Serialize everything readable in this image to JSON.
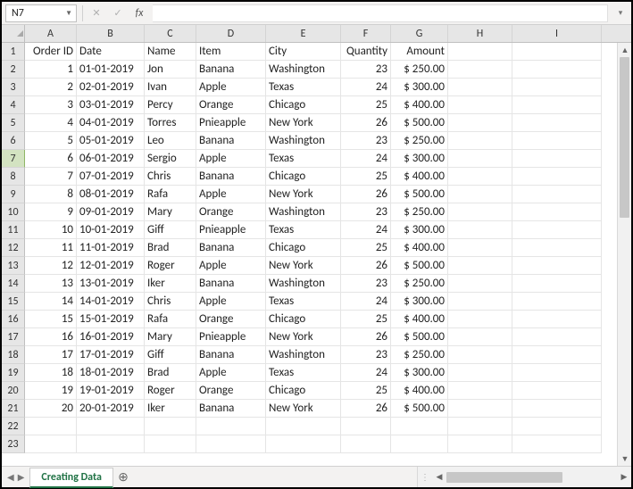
{
  "name_box": "N7",
  "formula_value": "",
  "columns": [
    "A",
    "B",
    "C",
    "D",
    "E",
    "F",
    "G",
    "H",
    "I"
  ],
  "col_widths": [
    "wA",
    "wB",
    "wC",
    "wD",
    "wE",
    "wF",
    "wG",
    "wH",
    "wI"
  ],
  "selected_row_header": 7,
  "headers_row_index": 1,
  "headers": {
    "A": "Order ID",
    "B": "Date",
    "C": "Name",
    "D": "Item",
    "E": "City",
    "F": "Quantity",
    "G": "Amount"
  },
  "data_rows": [
    {
      "rn": 2,
      "A": "1",
      "B": "01-01-2019",
      "C": "Jon",
      "D": "Banana",
      "E": "Washington",
      "F": "23",
      "G": "$ 250.00"
    },
    {
      "rn": 3,
      "A": "2",
      "B": "02-01-2019",
      "C": "Ivan",
      "D": "Apple",
      "E": "Texas",
      "F": "24",
      "G": "$ 300.00"
    },
    {
      "rn": 4,
      "A": "3",
      "B": "03-01-2019",
      "C": "Percy",
      "D": "Orange",
      "E": "Chicago",
      "F": "25",
      "G": "$ 400.00"
    },
    {
      "rn": 5,
      "A": "4",
      "B": "04-01-2019",
      "C": "Torres",
      "D": "Pnieapple",
      "E": "New York",
      "F": "26",
      "G": "$ 500.00"
    },
    {
      "rn": 6,
      "A": "5",
      "B": "05-01-2019",
      "C": "Leo",
      "D": "Banana",
      "E": "Washington",
      "F": "23",
      "G": "$ 250.00"
    },
    {
      "rn": 7,
      "A": "6",
      "B": "06-01-2019",
      "C": "Sergio",
      "D": "Apple",
      "E": "Texas",
      "F": "24",
      "G": "$ 300.00"
    },
    {
      "rn": 8,
      "A": "7",
      "B": "07-01-2019",
      "C": "Chris",
      "D": "Banana",
      "E": "Chicago",
      "F": "25",
      "G": "$ 400.00"
    },
    {
      "rn": 9,
      "A": "8",
      "B": "08-01-2019",
      "C": "Rafa",
      "D": "Apple",
      "E": "New York",
      "F": "26",
      "G": "$ 500.00"
    },
    {
      "rn": 10,
      "A": "9",
      "B": "09-01-2019",
      "C": "Mary",
      "D": "Orange",
      "E": "Washington",
      "F": "23",
      "G": "$ 250.00"
    },
    {
      "rn": 11,
      "A": "10",
      "B": "10-01-2019",
      "C": "Giff",
      "D": "Pnieapple",
      "E": "Texas",
      "F": "24",
      "G": "$ 300.00"
    },
    {
      "rn": 12,
      "A": "11",
      "B": "11-01-2019",
      "C": "Brad",
      "D": "Banana",
      "E": "Chicago",
      "F": "25",
      "G": "$ 400.00"
    },
    {
      "rn": 13,
      "A": "12",
      "B": "12-01-2019",
      "C": "Roger",
      "D": "Apple",
      "E": "New York",
      "F": "26",
      "G": "$ 500.00"
    },
    {
      "rn": 14,
      "A": "13",
      "B": "13-01-2019",
      "C": "Iker",
      "D": "Banana",
      "E": "Washington",
      "F": "23",
      "G": "$ 250.00"
    },
    {
      "rn": 15,
      "A": "14",
      "B": "14-01-2019",
      "C": "Chris",
      "D": "Apple",
      "E": "Texas",
      "F": "24",
      "G": "$ 300.00"
    },
    {
      "rn": 16,
      "A": "15",
      "B": "15-01-2019",
      "C": "Rafa",
      "D": "Orange",
      "E": "Chicago",
      "F": "25",
      "G": "$ 400.00"
    },
    {
      "rn": 17,
      "A": "16",
      "B": "16-01-2019",
      "C": "Mary",
      "D": "Pnieapple",
      "E": "New York",
      "F": "26",
      "G": "$ 500.00"
    },
    {
      "rn": 18,
      "A": "17",
      "B": "17-01-2019",
      "C": "Giff",
      "D": "Banana",
      "E": "Washington",
      "F": "23",
      "G": "$ 250.00"
    },
    {
      "rn": 19,
      "A": "18",
      "B": "18-01-2019",
      "C": "Brad",
      "D": "Apple",
      "E": "Texas",
      "F": "24",
      "G": "$ 300.00"
    },
    {
      "rn": 20,
      "A": "19",
      "B": "19-01-2019",
      "C": "Roger",
      "D": "Orange",
      "E": "Chicago",
      "F": "25",
      "G": "$ 400.00"
    },
    {
      "rn": 21,
      "A": "20",
      "B": "20-01-2019",
      "C": "Iker",
      "D": "Banana",
      "E": "New York",
      "F": "26",
      "G": "$ 500.00"
    }
  ],
  "trailing_blank_rows": [
    22,
    23
  ],
  "sheet_tab": "Creating Data",
  "numeric_cols": [
    "A",
    "F"
  ],
  "right_align_cols_G": true
}
